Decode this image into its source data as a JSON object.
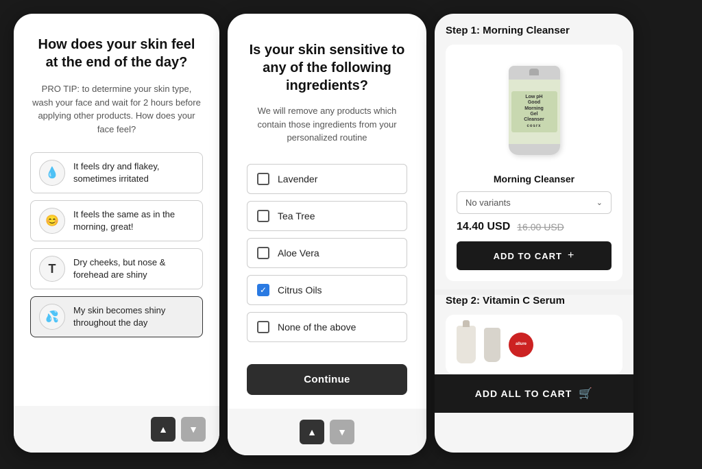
{
  "left": {
    "title": "How does your skin feel at the end of the day?",
    "pro_tip": "PRO TIP: to determine your skin type, wash your face and wait for 2 hours before applying other products. How does your face feel?",
    "options": [
      {
        "id": "dry",
        "icon": "💧",
        "text": "It feels dry and flakey, sometimes irritated"
      },
      {
        "id": "same",
        "icon": "😊",
        "text": "It feels the same as in the morning, great!"
      },
      {
        "id": "combo",
        "icon": "T",
        "text": "Dry cheeks, but nose & forehead are shiny"
      },
      {
        "id": "oily",
        "icon": "💦",
        "text": "My skin becomes shiny throughout the day"
      }
    ],
    "nav_up_label": "▲",
    "nav_down_label": "▼"
  },
  "middle": {
    "title": "Is your skin sensitive to any of the following ingredients?",
    "subtitle": "We will remove any products which contain those ingredients from your personalized routine",
    "ingredients": [
      {
        "id": "lavender",
        "label": "Lavender",
        "checked": false
      },
      {
        "id": "tea-tree",
        "label": "Tea Tree",
        "checked": false
      },
      {
        "id": "aloe-vera",
        "label": "Aloe Vera",
        "checked": false
      },
      {
        "id": "citrus-oils",
        "label": "Citrus Oils",
        "checked": true
      },
      {
        "id": "none",
        "label": "None of the above",
        "checked": false
      }
    ],
    "continue_label": "Continue",
    "nav_up_label": "▲",
    "nav_down_label": "▼"
  },
  "right": {
    "step1_title": "Step 1: Morning Cleanser",
    "product1_name": "Morning Cleanser",
    "variant_label": "No variants",
    "price_current": "14.40 USD",
    "price_original": "16.00 USD",
    "add_to_cart_label": "ADD TO CART",
    "plus_icon": "+",
    "step2_title": "Step 2: Vitamin C Serum",
    "add_all_label": "ADD ALL TO CART",
    "cart_icon": "🛒",
    "brand_line1": "Low pH",
    "brand_line2": "Good",
    "brand_line3": "Morning",
    "brand_line4": "Gel",
    "brand_line5": "Cleanser",
    "brand_name": "cosrx"
  }
}
